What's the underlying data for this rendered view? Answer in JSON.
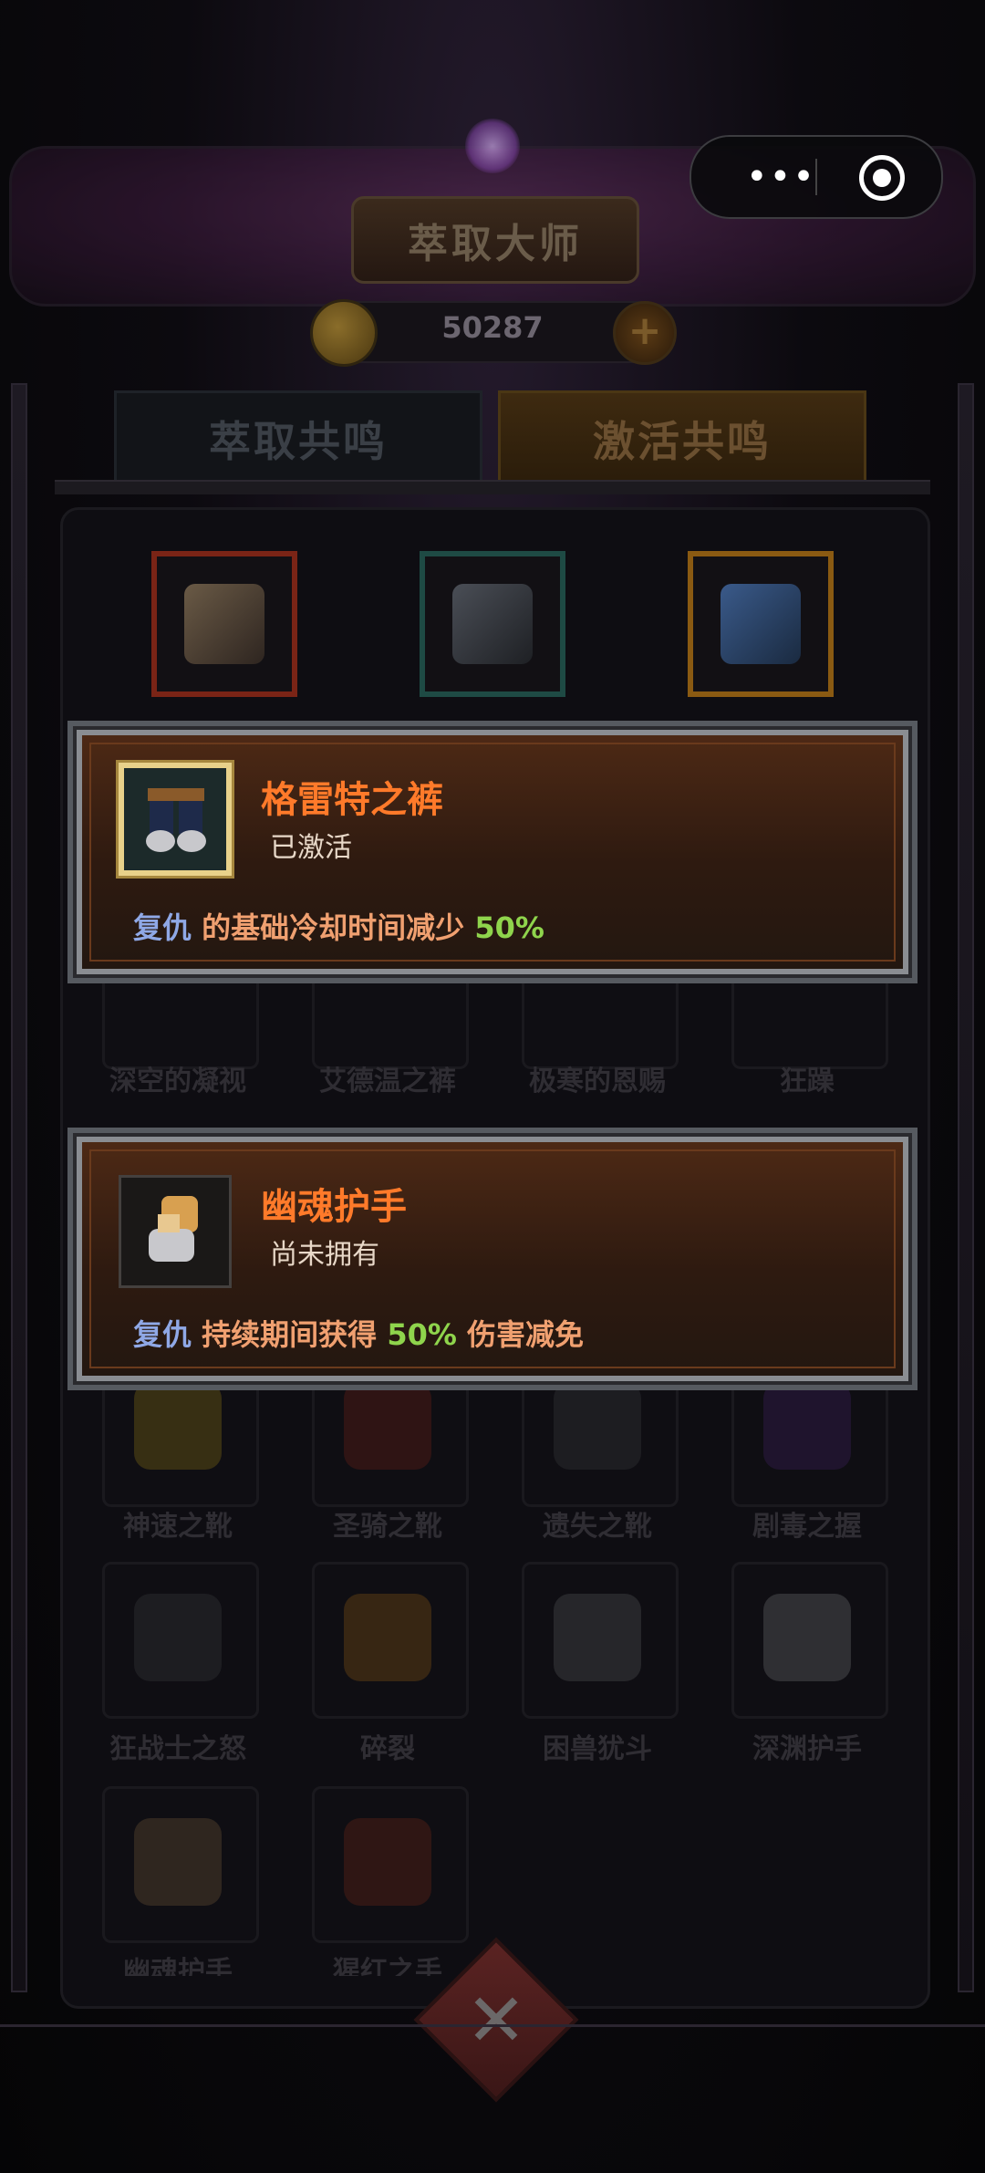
{
  "header": {
    "title": "萃取大师",
    "coins": "50287",
    "plus": "+"
  },
  "capsule": {
    "more": "•••"
  },
  "tabs": [
    {
      "label": "萃取共鸣"
    },
    {
      "label": "激活共鸣"
    }
  ],
  "top_slots": [
    {
      "icon": "bracer-icon",
      "color": "#7a2416"
    },
    {
      "icon": "greaves-icon",
      "color": "#1e4a44"
    },
    {
      "icon": "amulet-icon",
      "color": "#8a5a12"
    }
  ],
  "grid": {
    "row1": [
      "深空的凝视",
      "艾德温之裤",
      "极寒的恩赐",
      "狂躁"
    ],
    "row2": [
      "神速之靴",
      "圣骑之靴",
      "遗失之靴",
      "剧毒之握"
    ],
    "row3": [
      "狂战士之怒",
      "碎裂",
      "困兽犹斗",
      "深渊护手"
    ],
    "row4": [
      "幽魂护手",
      "猩红之手"
    ]
  },
  "popups": [
    {
      "name": "格雷特之裤",
      "status": "已激活",
      "keyword": "复仇",
      "text1": "的基础冷却时间减少",
      "percent": "50%",
      "text2": "",
      "icon": "pants-icon"
    },
    {
      "name": "幽魂护手",
      "status": "尚未拥有",
      "keyword": "复仇",
      "text1": "持续期间获得",
      "percent": "50%",
      "text2": "伤害减免",
      "icon": "gauntlet-icon"
    }
  ],
  "colors": {
    "name": "#ff7a2a",
    "keyword": "#8fa8e6",
    "desc": "#f0a070",
    "percent": "#8fd44c",
    "frame": "#8a8d92"
  }
}
